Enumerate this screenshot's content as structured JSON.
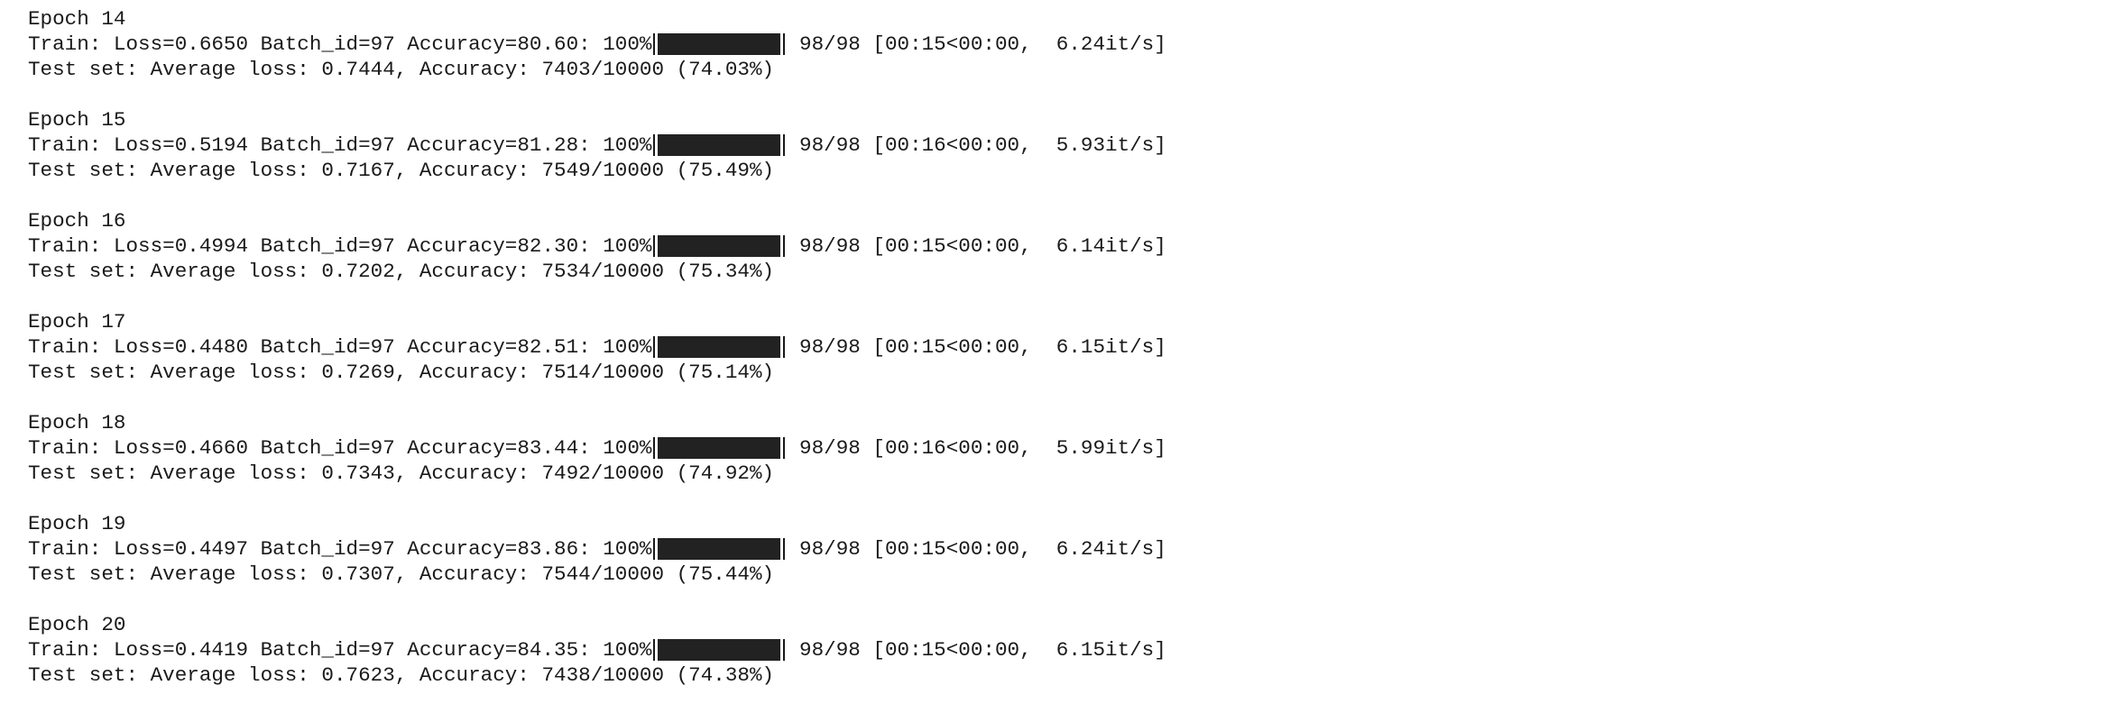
{
  "epochs": [
    {
      "header": "Epoch 14",
      "train_prefix": "Train: Loss=0.6650 Batch_id=97 Accuracy=80.60: 100%",
      "progress_fraction": 1.0,
      "train_suffix": " 98/98 [00:15<00:00,  6.24it/s]",
      "test": "Test set: Average loss: 0.7444, Accuracy: 7403/10000 (74.03%)"
    },
    {
      "header": "Epoch 15",
      "train_prefix": "Train: Loss=0.5194 Batch_id=97 Accuracy=81.28: 100%",
      "progress_fraction": 1.0,
      "train_suffix": " 98/98 [00:16<00:00,  5.93it/s]",
      "test": "Test set: Average loss: 0.7167, Accuracy: 7549/10000 (75.49%)"
    },
    {
      "header": "Epoch 16",
      "train_prefix": "Train: Loss=0.4994 Batch_id=97 Accuracy=82.30: 100%",
      "progress_fraction": 1.0,
      "train_suffix": " 98/98 [00:15<00:00,  6.14it/s]",
      "test": "Test set: Average loss: 0.7202, Accuracy: 7534/10000 (75.34%)"
    },
    {
      "header": "Epoch 17",
      "train_prefix": "Train: Loss=0.4480 Batch_id=97 Accuracy=82.51: 100%",
      "progress_fraction": 1.0,
      "train_suffix": " 98/98 [00:15<00:00,  6.15it/s]",
      "test": "Test set: Average loss: 0.7269, Accuracy: 7514/10000 (75.14%)"
    },
    {
      "header": "Epoch 18",
      "train_prefix": "Train: Loss=0.4660 Batch_id=97 Accuracy=83.44: 100%",
      "progress_fraction": 1.0,
      "train_suffix": " 98/98 [00:16<00:00,  5.99it/s]",
      "test": "Test set: Average loss: 0.7343, Accuracy: 7492/10000 (74.92%)"
    },
    {
      "header": "Epoch 19",
      "train_prefix": "Train: Loss=0.4497 Batch_id=97 Accuracy=83.86: 100%",
      "progress_fraction": 1.0,
      "train_suffix": " 98/98 [00:15<00:00,  6.24it/s]",
      "test": "Test set: Average loss: 0.7307, Accuracy: 7544/10000 (75.44%)"
    },
    {
      "header": "Epoch 20",
      "train_prefix": "Train: Loss=0.4419 Batch_id=97 Accuracy=84.35: 100%",
      "progress_fraction": 1.0,
      "train_suffix": " 98/98 [00:15<00:00,  6.15it/s]",
      "test": "Test set: Average loss: 0.7623, Accuracy: 7438/10000 (74.38%)"
    }
  ],
  "colors": {
    "text": "#1a1a1a",
    "bar_fill": "#222222",
    "background": "#ffffff"
  }
}
